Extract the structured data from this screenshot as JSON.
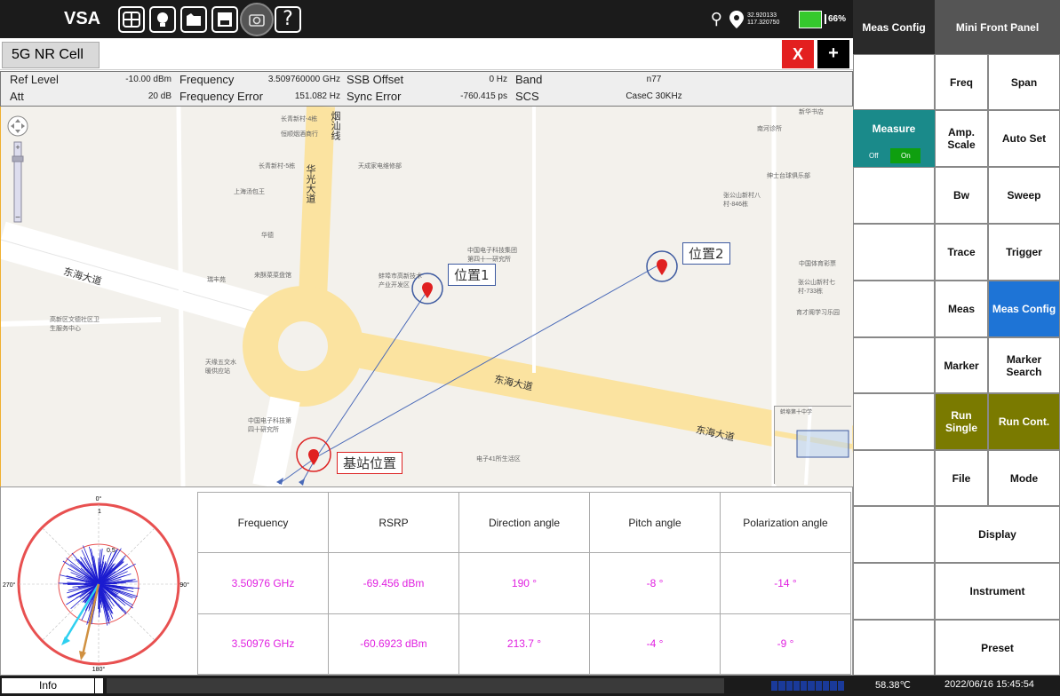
{
  "topbar": {
    "app_title": "VSA",
    "icons": [
      "windows-icon",
      "lightbulb-icon",
      "folder-open-icon",
      "save-icon",
      "camera-icon",
      "help-icon"
    ],
    "help_glyph": "?",
    "gps_lat": "32.920133",
    "gps_lon": "117.320750",
    "battery": "66%"
  },
  "tabs": {
    "active": "5G NR Cell",
    "close": "X",
    "add": "+"
  },
  "info": {
    "ref_level_label": "Ref Level",
    "ref_level_value": "-10.00 dBm",
    "frequency_label": "Frequency",
    "frequency_value": "3.509760000 GHz",
    "ssb_offset_label": "SSB Offset",
    "ssb_offset_value": "0 Hz",
    "band_label": "Band",
    "band_value": "n77",
    "att_label": "Att",
    "att_value": "20 dB",
    "freq_error_label": "Frequency Error",
    "freq_error_value": "151.082 Hz",
    "sync_error_label": "Sync Error",
    "sync_error_value": "-760.415 ps",
    "scs_label": "SCS",
    "scs_value": "CaseC 30KHz"
  },
  "map": {
    "callouts": {
      "pos1": "位置1",
      "pos2": "位置2",
      "base": "基站位置"
    },
    "roads": {
      "donghai_left": "东海大道",
      "donghai_mid": "东海大道",
      "donghai_right": "东海大道",
      "huaguang": "华光大道",
      "yanshan": "烟汕线"
    },
    "pois": [
      "长青新村-4栋",
      "恒顺烟酒商行",
      "天成家电维修部",
      "长青新村-5栋",
      "上海汤包王",
      "华德",
      "中国电子科技集团第四十一研究所",
      "蚌埠市高新技术产业开发区",
      "来酥菜菜盘馆",
      "瑞丰苑",
      "高新区文德社区卫生服务中心",
      "天缘五交水暖供应站",
      "中国电子科技第四十研究所",
      "电子41所生活区",
      "中国体育彩票",
      "张公山新村七村-733栋",
      "育才阁学习乐园",
      "绅士台球俱乐部",
      "张公山新村八村-846栋",
      "南河诊所",
      "新华书店",
      "蚌埠第十中学"
    ]
  },
  "polar": {
    "top": "0°",
    "right": "90°",
    "bottom": "180°",
    "left": "270°",
    "ring_outer": "1",
    "ring_inner": "0.5"
  },
  "results": {
    "headers": [
      "Frequency",
      "RSRP",
      "Direction angle",
      "Pitch angle",
      "Polarization angle"
    ],
    "rows": [
      [
        "3.50976 GHz",
        "-69.456 dBm",
        "190 °",
        "-8 °",
        "-14 °"
      ],
      [
        "3.50976 GHz",
        "-60.6923 dBm",
        "213.7 °",
        "-4 °",
        "-9 °"
      ]
    ],
    "direction_angles": [
      190,
      213.7
    ]
  },
  "statusbar": {
    "info": "Info",
    "temperature": "58.38℃",
    "datetime": "2022/06/16 15:45:54"
  },
  "rpanel": {
    "meas_config": "Meas Config",
    "mini_front_panel": "Mini Front Panel",
    "measure": "Measure",
    "measure_off": "Off",
    "measure_on": "On",
    "freq": "Freq",
    "span": "Span",
    "amp_scale": "Amp. Scale",
    "auto_set": "Auto Set",
    "bw": "Bw",
    "sweep": "Sweep",
    "trace": "Trace",
    "trigger": "Trigger",
    "meas": "Meas",
    "meas_config_btn": "Meas Config",
    "marker": "Marker",
    "marker_search": "Marker Search",
    "run_single": "Run Single",
    "run_cont": "Run Cont.",
    "file": "File",
    "mode": "Mode",
    "display": "Display",
    "instrument": "Instrument",
    "preset": "Preset"
  },
  "colors": {
    "accent_magenta": "#e020e0",
    "run_olive": "#7a7a00",
    "active_blue": "#1e74d6",
    "measure_teal": "#1a8a8a"
  }
}
